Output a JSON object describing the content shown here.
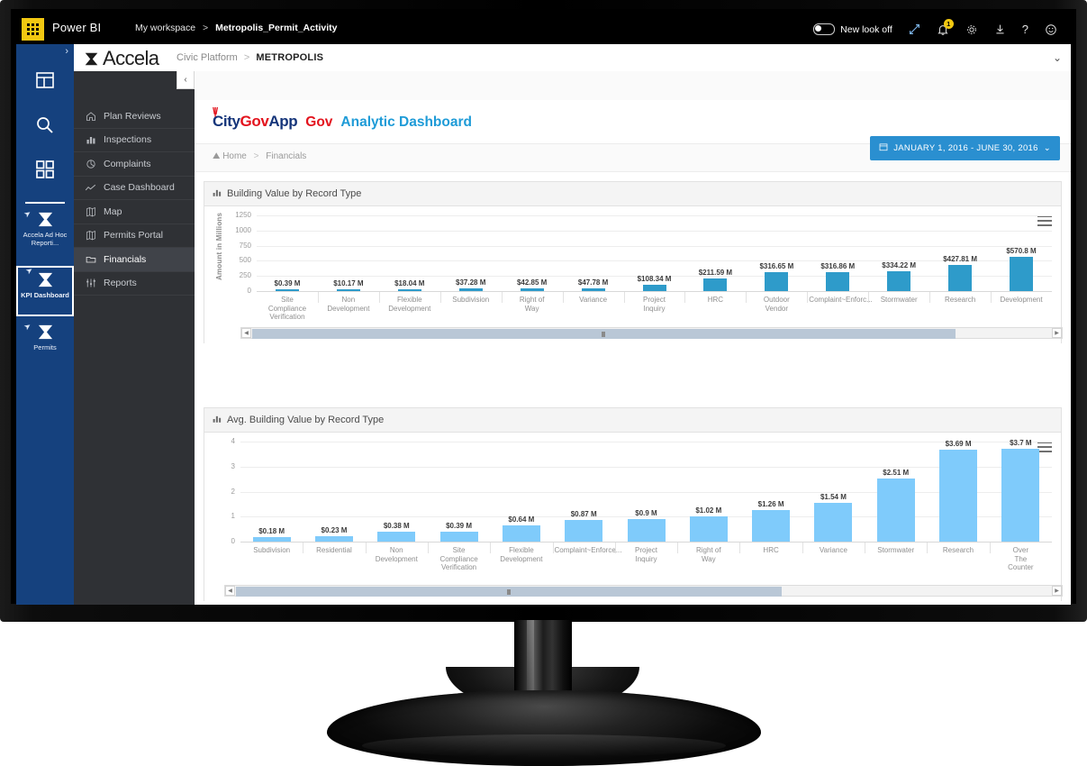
{
  "powerbi": {
    "app_name": "Power BI",
    "workspace": "My workspace",
    "report": "Metropolis_Permit_Activity",
    "new_look_label": "New look off",
    "icons": {
      "waffle": "app-launcher-icon",
      "expand": "fullscreen-icon",
      "notifications": "notification-bell-icon",
      "notification_count": "1",
      "settings": "gear-icon",
      "download": "download-icon",
      "help": "help-icon",
      "feedback": "smiley-feedback-icon"
    }
  },
  "accela": {
    "brand": "Accela",
    "platform": "Civic Platform",
    "agency": "METROPOLIS",
    "separator": ">"
  },
  "citygovapp": {
    "name_part1": "City",
    "name_part2": "Gov",
    "name_part3": "App"
  },
  "rail": {
    "expand_icon": "chevron-right-icon",
    "top_icons": [
      {
        "name": "report-layout-icon"
      },
      {
        "name": "search-icon"
      },
      {
        "name": "apps-grid-icon"
      }
    ],
    "tiles": [
      {
        "label": "Accela Ad Hoc Reporti...",
        "selected": false
      },
      {
        "label": "KPI Dashboard",
        "selected": true
      },
      {
        "label": "Permits",
        "selected": false
      }
    ]
  },
  "nav": {
    "collapse_icon": "chevron-left-icon",
    "items": [
      {
        "label": "Plan Reviews",
        "icon": "home-icon",
        "active": false
      },
      {
        "label": "Inspections",
        "icon": "bar-chart-icon",
        "active": false
      },
      {
        "label": "Complaints",
        "icon": "pie-chart-icon",
        "active": false
      },
      {
        "label": "Case Dashboard",
        "icon": "line-chart-icon",
        "active": false
      },
      {
        "label": "Map",
        "icon": "map-icon",
        "active": false
      },
      {
        "label": "Permits Portal",
        "icon": "map-icon",
        "active": false
      },
      {
        "label": "Financials",
        "icon": "folder-icon",
        "active": true
      },
      {
        "label": "Reports",
        "icon": "sliders-icon",
        "active": false
      }
    ]
  },
  "dashboard": {
    "title_logo1": "City",
    "title_logo2": "Gov",
    "title_logo3": "App",
    "title_red": "Gov",
    "title_blue": "Analytic Dashboard",
    "breadcrumb_home": "Home",
    "breadcrumb_sep": ">",
    "breadcrumb_current": "Financials",
    "date_range": "JANUARY 1, 2016 - JUNE 30, 2016",
    "date_icon": "calendar-icon",
    "date_chevron": "chevron-down-icon"
  },
  "panels": [
    {
      "title": "Building Value by Record Type",
      "icon": "bar-chart-icon",
      "menu_icon": "hamburger-menu-icon"
    },
    {
      "title": "Avg. Building Value by Record Type",
      "icon": "bar-chart-icon",
      "menu_icon": "hamburger-menu-icon"
    }
  ],
  "colors": {
    "accent_blue": "#2a8fd0",
    "bar_chart1": "#2E9BCA",
    "bar_chart2": "#7FCBFB",
    "rail_blue": "#15417e",
    "nav_dark": "#2f3135",
    "brand_red": "#e3131d",
    "brand_navy": "#15357a",
    "powerbi_yellow": "#F2C811"
  },
  "chart_data": [
    {
      "type": "bar",
      "title": "Building Value by Record Type",
      "xlabel": "",
      "ylabel": "Amount in Millions",
      "ylim": [
        0,
        1250
      ],
      "yticks": [
        0,
        250,
        500,
        750,
        1000,
        1250
      ],
      "grid": true,
      "legend": "none",
      "bar_color": "#2E9BCA",
      "categories": [
        "Site Compliance Verification",
        "Non Development",
        "Flexible Development",
        "Subdivision",
        "Right of Way",
        "Variance",
        "Project Inquiry",
        "HRC",
        "Outdoor Vendor",
        "Complaint~Enforc...",
        "Stormwater",
        "Research",
        "Development"
      ],
      "values": [
        0.39,
        10.17,
        18.04,
        37.28,
        42.85,
        47.78,
        108.34,
        211.59,
        316.65,
        316.86,
        334.22,
        427.81,
        570.8
      ],
      "data_labels": [
        "$0.39 M",
        "$10.17 M",
        "$18.04 M",
        "$37.28 M",
        "$42.85 M",
        "$47.78 M",
        "$108.34 M",
        "$211.59 M",
        "$316.65 M",
        "$316.86 M",
        "$334.22 M",
        "$427.81 M",
        "$570.8 M"
      ],
      "scrollbar": {
        "thumb_start_pct": 0,
        "thumb_width_pct": 88
      }
    },
    {
      "type": "bar",
      "title": "Avg. Building Value by Record Type",
      "xlabel": "",
      "ylabel": "",
      "ylim": [
        0,
        4
      ],
      "yticks": [
        0,
        1,
        2,
        3,
        4
      ],
      "grid": true,
      "legend": "none",
      "bar_color": "#7FCBFB",
      "categories": [
        "Subdivision",
        "Residential",
        "Non Development",
        "Site Compliance Verification",
        "Flexible Development",
        "Complaint~Enforce...",
        "Project Inquiry",
        "Right of Way",
        "HRC",
        "Variance",
        "Stormwater",
        "Research",
        "Over The Counter"
      ],
      "values": [
        0.18,
        0.23,
        0.38,
        0.39,
        0.64,
        0.87,
        0.9,
        1.02,
        1.26,
        1.54,
        2.51,
        3.69,
        3.7
      ],
      "data_labels": [
        "$0.18 M",
        "$0.23 M",
        "$0.38 M",
        "$0.39 M",
        "$0.64 M",
        "$0.87 M",
        "$0.9 M",
        "$1.02 M",
        "$1.26 M",
        "$1.54 M",
        "$2.51 M",
        "$3.69 M",
        "$3.7 M"
      ],
      "scrollbar": {
        "thumb_start_pct": 0,
        "thumb_width_pct": 67
      }
    }
  ]
}
